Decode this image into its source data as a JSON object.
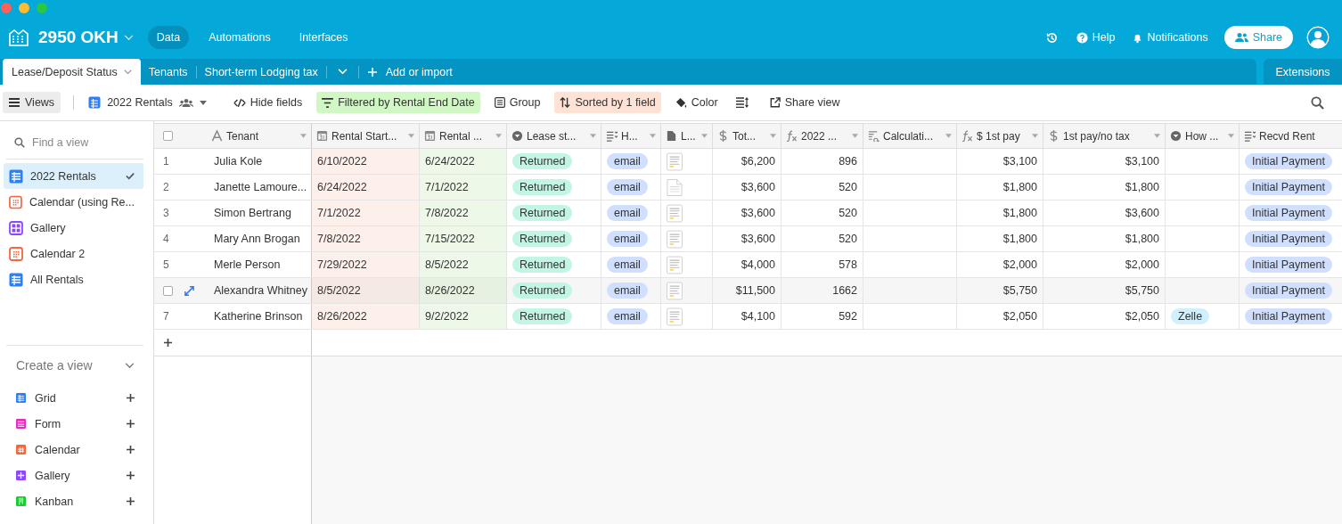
{
  "base": {
    "name": "2950 OKH"
  },
  "nav": [
    {
      "label": "Data",
      "selected": true
    },
    {
      "label": "Automations",
      "selected": false
    },
    {
      "label": "Interfaces",
      "selected": false
    }
  ],
  "top_actions": [
    {
      "kind": "history"
    },
    {
      "kind": "help",
      "label": "Help"
    },
    {
      "kind": "notifications",
      "label": "Notifications"
    }
  ],
  "share_button": {
    "label": "Share"
  },
  "tables": [
    {
      "label": "Lease/Deposit Status",
      "selected": true
    },
    {
      "label": "Tenants",
      "selected": false
    },
    {
      "label": "Short-term Lodging tax",
      "selected": false
    }
  ],
  "add_table": {
    "label": "Add or import"
  },
  "extensions": {
    "label": "Extensions"
  },
  "toolbar": {
    "views_button": "Views",
    "view_name": "2022 Rentals",
    "items": [
      {
        "kind": "hide",
        "label": "Hide fields"
      },
      {
        "kind": "filter",
        "label": "Filtered by Rental End Date",
        "color": "#d1f7c4"
      },
      {
        "kind": "group",
        "label": "Group"
      },
      {
        "kind": "sort",
        "label": "Sorted by 1 field",
        "color": "#fee2d5"
      },
      {
        "kind": "color",
        "label": "Color"
      },
      {
        "kind": "row-height"
      },
      {
        "kind": "share",
        "label": "Share view"
      }
    ]
  },
  "sidebar": {
    "search": {
      "placeholder": "Find a view"
    },
    "views": [
      {
        "label": "2022 Rentals",
        "kind": "grid",
        "selected": true
      },
      {
        "label": "Calendar (using Re...",
        "kind": "calendar",
        "selected": false
      },
      {
        "label": "Gallery",
        "kind": "gallery",
        "selected": false
      },
      {
        "label": "Calendar 2",
        "kind": "calendar",
        "selected": false
      },
      {
        "label": "All Rentals",
        "kind": "grid",
        "selected": false
      }
    ],
    "create_title": "Create a view",
    "create_items": [
      {
        "label": "Grid",
        "kind": "grid"
      },
      {
        "label": "Form",
        "kind": "form"
      },
      {
        "label": "Calendar",
        "kind": "calendar"
      },
      {
        "label": "Gallery",
        "kind": "gallery"
      },
      {
        "label": "Kanban",
        "kind": "kanban"
      }
    ]
  },
  "grid": {
    "select_all": {
      "checked": false
    },
    "columns": [
      {
        "label": "Tenant",
        "kind": "text"
      },
      {
        "label": "Rental Start...",
        "kind": "date",
        "color": "#fdf0eb"
      },
      {
        "label": "Rental ...",
        "kind": "date",
        "color": "#edf8e9"
      },
      {
        "label": "Lease st...",
        "kind": "select"
      },
      {
        "label": "H...",
        "kind": "multiselect"
      },
      {
        "label": "L...",
        "kind": "attachment"
      },
      {
        "label": "Tot...",
        "kind": "currency"
      },
      {
        "label": "2022 ...",
        "kind": "formula"
      },
      {
        "label": "Calculati...",
        "kind": "lookup"
      },
      {
        "label": "$ 1st pay",
        "kind": "formula"
      },
      {
        "label": "1st pay/no tax",
        "kind": "currency"
      },
      {
        "label": "How ...",
        "kind": "select"
      },
      {
        "label": "Recvd Rent",
        "kind": "multiselect"
      }
    ],
    "rows": [
      {
        "number": "1",
        "hovered": false,
        "checked": false,
        "cells": [
          "Julia Kole",
          "6/10/2022",
          "6/24/2022",
          {
            "text": "Returned",
            "color": "#c2f5e4"
          },
          {
            "text": "email",
            "color": "#cfdffd"
          },
          {
            "kind": "thumbnail"
          },
          "$6,200",
          "896",
          null,
          "$3,100",
          "$3,100",
          null,
          {
            "text": "Initial Payment",
            "color": "#cfdffd"
          }
        ]
      },
      {
        "number": "2",
        "hovered": false,
        "checked": false,
        "cells": [
          "Janette Lamoure...",
          "6/24/2022",
          "7/1/2022",
          {
            "text": "Returned",
            "color": "#c2f5e4"
          },
          {
            "text": "email",
            "color": "#cfdffd"
          },
          {
            "kind": "file"
          },
          "$3,600",
          "520",
          null,
          "$1,800",
          "$1,800",
          null,
          {
            "text": "Initial Payment",
            "color": "#cfdffd"
          }
        ]
      },
      {
        "number": "3",
        "hovered": false,
        "checked": false,
        "cells": [
          "Simon Bertrang",
          "7/1/2022",
          "7/8/2022",
          {
            "text": "Returned",
            "color": "#c2f5e4"
          },
          {
            "text": "email",
            "color": "#cfdffd"
          },
          {
            "kind": "thumbnail"
          },
          "$3,600",
          "520",
          null,
          "$1,800",
          "$3,600",
          null,
          {
            "text": "Initial Payment",
            "color": "#cfdffd"
          }
        ]
      },
      {
        "number": "4",
        "hovered": false,
        "checked": false,
        "cells": [
          "Mary Ann Brogan",
          "7/8/2022",
          "7/15/2022",
          {
            "text": "Returned",
            "color": "#c2f5e4"
          },
          {
            "text": "email",
            "color": "#cfdffd"
          },
          {
            "kind": "thumbnail"
          },
          "$3,600",
          "520",
          null,
          "$1,800",
          "$1,800",
          null,
          {
            "text": "Initial Payment",
            "color": "#cfdffd"
          }
        ]
      },
      {
        "number": "5",
        "hovered": false,
        "checked": false,
        "cells": [
          "Merle Person",
          "7/29/2022",
          "8/5/2022",
          {
            "text": "Returned",
            "color": "#c2f5e4"
          },
          {
            "text": "email",
            "color": "#cfdffd"
          },
          {
            "kind": "thumbnail"
          },
          "$4,000",
          "578",
          null,
          "$2,000",
          "$2,000",
          null,
          {
            "text": "Initial Payment",
            "color": "#cfdffd"
          }
        ]
      },
      {
        "hovered": true,
        "checked": false,
        "cells": [
          "Alexandra Whitney",
          "8/5/2022",
          "8/26/2022",
          {
            "text": "Returned",
            "color": "#c2f5e4"
          },
          {
            "text": "email",
            "color": "#cfdffd"
          },
          {
            "kind": "thumbnail"
          },
          "$11,500",
          "1662",
          null,
          "$5,750",
          "$5,750",
          null,
          {
            "text": "Initial Payment",
            "color": "#cfdffd"
          }
        ]
      },
      {
        "number": "7",
        "hovered": false,
        "checked": false,
        "cells": [
          "Katherine Brinson",
          "8/26/2022",
          "9/2/2022",
          {
            "text": "Returned",
            "color": "#c2f5e4"
          },
          {
            "text": "email",
            "color": "#cfdffd"
          },
          {
            "kind": "thumbnail"
          },
          "$4,100",
          "592",
          null,
          "$2,050",
          "$2,050",
          {
            "text": "Zelle",
            "color": "#d0f0fd"
          },
          {
            "text": "Initial Payment",
            "color": "#cfdffd"
          }
        ]
      }
    ]
  }
}
